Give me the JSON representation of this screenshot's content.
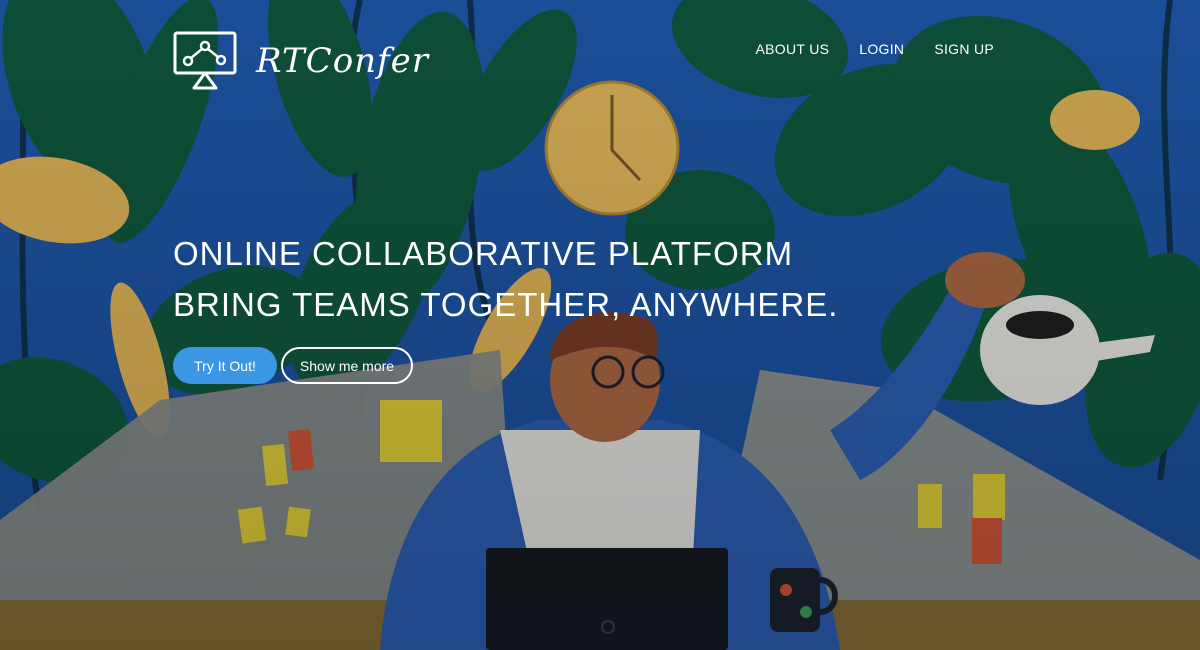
{
  "brand": {
    "name": "RTConfer",
    "logo_icon": "presentation-screen-icon"
  },
  "nav": {
    "items": [
      "ABOUT US",
      "LOGIN",
      "SIGN UP"
    ]
  },
  "hero": {
    "headline_line1": "ONLINE COLLABORATIVE PLATFORM",
    "headline_line2": "BRING TEAMS TOGETHER, ANYWHERE.",
    "primary_button": "Try It Out!",
    "secondary_button": "Show me more"
  },
  "colors": {
    "background_blue": "#1f56a8",
    "leaf_green": "#0f5a3f",
    "accent_yellow": "#e6b95a",
    "primary_button": "#3b97e3",
    "text": "#ffffff"
  }
}
